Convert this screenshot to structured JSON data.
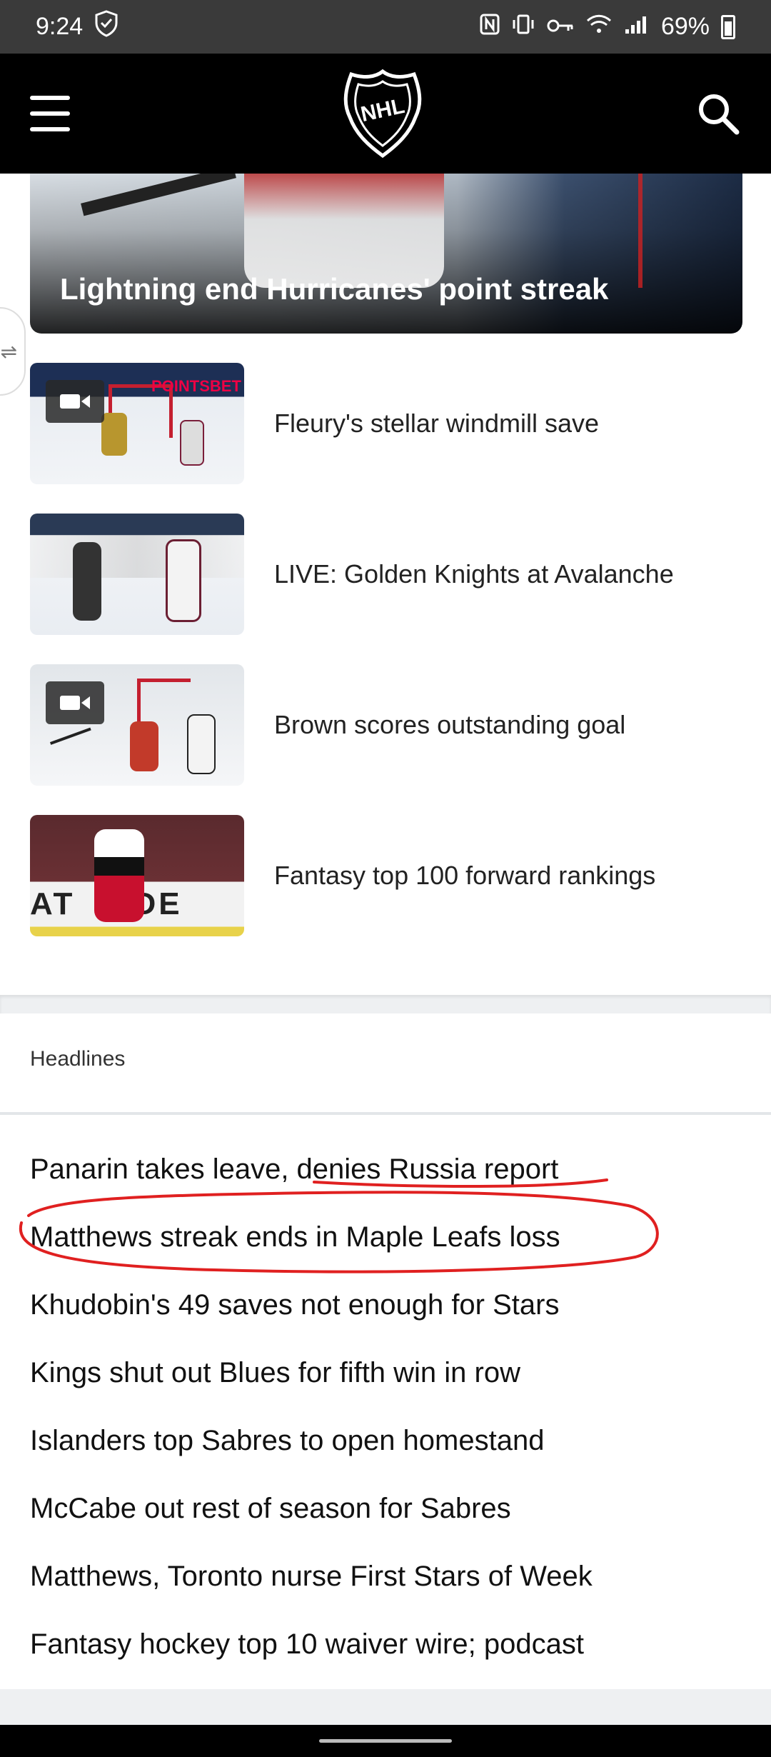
{
  "status_bar": {
    "time": "9:24",
    "battery_percent": "69%",
    "icons": [
      "shield-icon",
      "nfc-icon",
      "vibrate-icon",
      "vpn-key-icon",
      "wifi-icon",
      "signal-icon",
      "battery-icon"
    ]
  },
  "header": {
    "menu_icon": "hamburger-menu-icon",
    "logo": "NHL",
    "search_icon": "search-icon"
  },
  "hero": {
    "title": "Lightning end Hurricanes' point streak"
  },
  "videos": [
    {
      "title": "Fleury's stellar windmill save",
      "has_video": true
    },
    {
      "title": "LIVE: Golden Knights at Avalanche",
      "has_video": false
    },
    {
      "title": "Brown scores outstanding goal",
      "has_video": true
    },
    {
      "title": "Fantasy top 100 forward rankings",
      "has_video": false
    }
  ],
  "headlines": {
    "heading": "Headlines",
    "items": [
      "Panarin takes leave, denies Russia report",
      "Matthews streak ends in Maple Leafs loss",
      "Khudobin's 49 saves not enough for Stars",
      "Kings shut out Blues for fifth win in row",
      "Islanders top Sabres to open homestand",
      "McCabe out rest of season for Sabres",
      "Matthews, Toronto nurse First Stars of Week",
      "Fantasy hockey top 10 waiver wire; podcast"
    ]
  },
  "colors": {
    "header_bg": "#000000",
    "status_bg": "#3a3a3a",
    "annotation": "#e02020"
  }
}
